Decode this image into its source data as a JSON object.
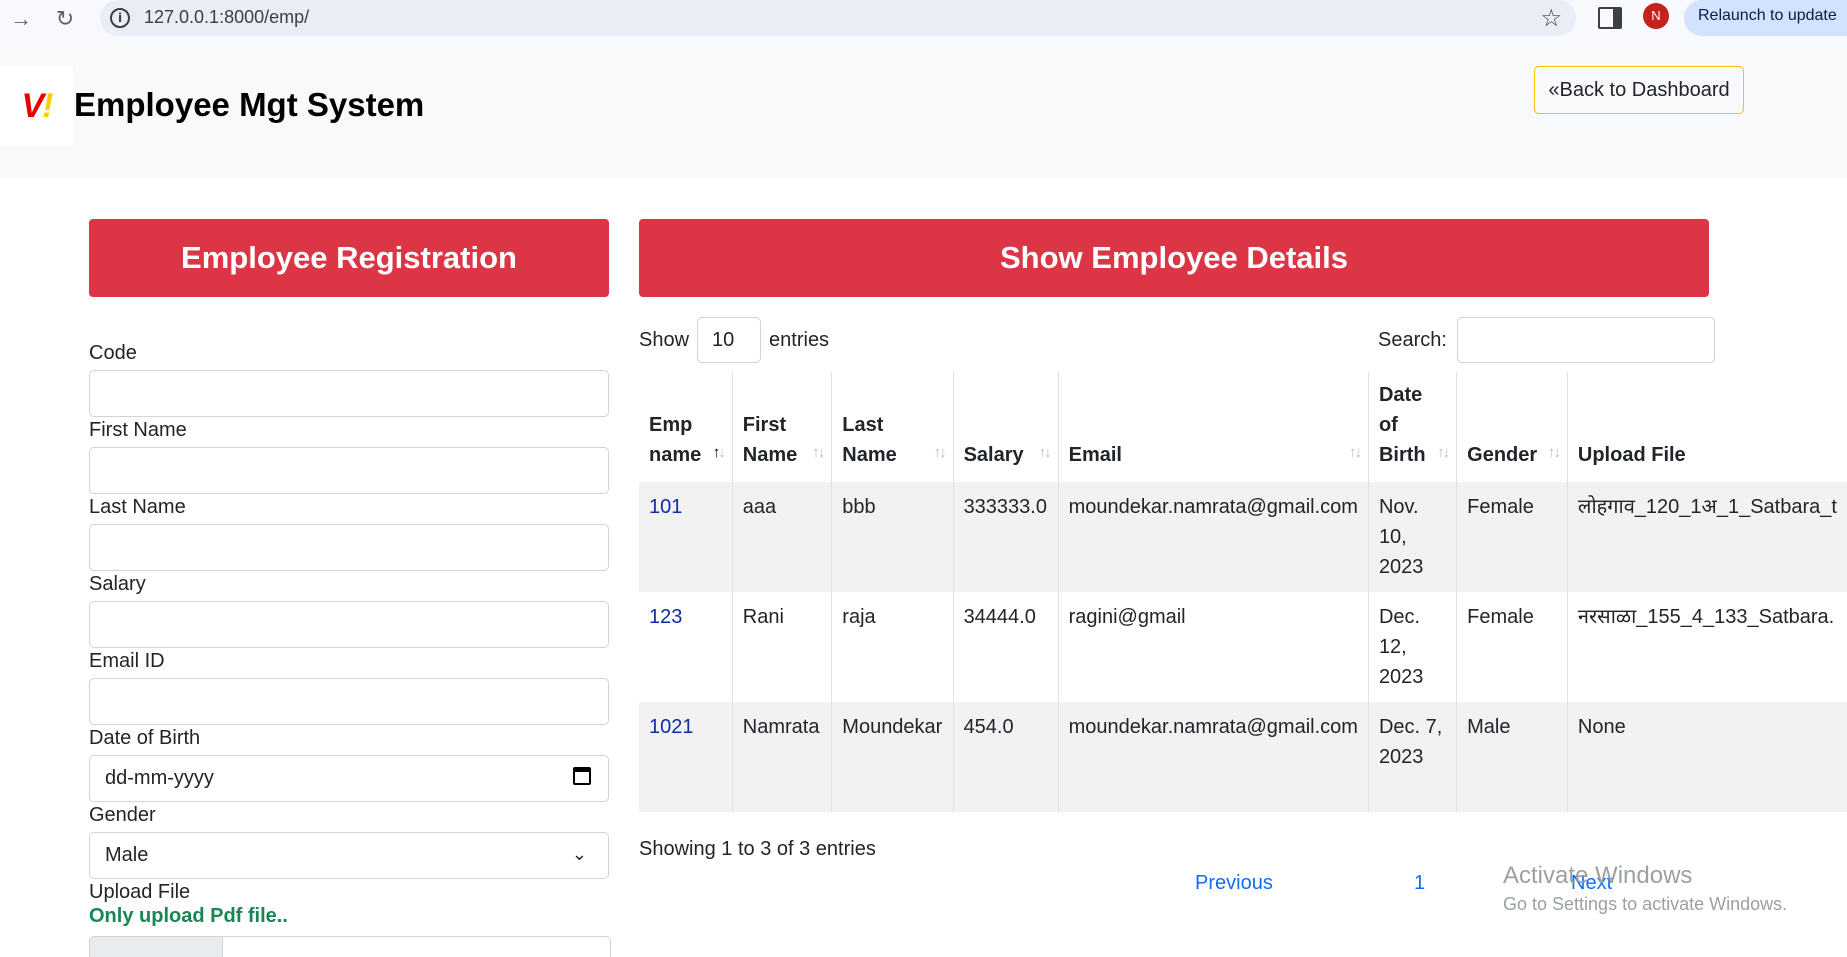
{
  "browser": {
    "url": "127.0.0.1:8000/emp/",
    "avatar_initial": "N",
    "relaunch_label": "Relaunch to update"
  },
  "header": {
    "logo_text": "V",
    "logo_dot": "!",
    "brand": "Employee Mgt System",
    "back_button": "«Back to Dashboard"
  },
  "registration": {
    "title": "Employee Registration",
    "fields": {
      "code": "Code",
      "first_name": "First Name",
      "last_name": "Last Name",
      "salary": "Salary",
      "email": "Email ID",
      "dob": "Date of Birth",
      "dob_placeholder": "dd-mm-yyyy",
      "gender": "Gender",
      "gender_value": "Male",
      "upload": "Upload File",
      "upload_note": "Only upload Pdf file.."
    }
  },
  "details": {
    "title": "Show Employee Details",
    "show_label": "Show",
    "entries_value": "10",
    "entries_label": "entries",
    "search_label": "Search:",
    "columns": [
      "Emp name",
      "First Name",
      "Last Name",
      "Salary",
      "Email",
      "Date of Birth",
      "Gender",
      "Upload File"
    ],
    "rows": [
      {
        "emp": "101",
        "first": "aaa",
        "last": "bbb",
        "salary": "333333.0",
        "email": "moundekar.namrata@gmail.com",
        "dob": "Nov. 10, 2023",
        "gender": "Female",
        "file": "लोहगाव_120_1अ_1_Satbara_t"
      },
      {
        "emp": "123",
        "first": "Rani",
        "last": "raja",
        "salary": "34444.0",
        "email": "ragini@gmail",
        "dob": "Dec. 12, 2023",
        "gender": "Female",
        "file": "नरसाळा_155_4_133_Satbara."
      },
      {
        "emp": "1021",
        "first": "Namrata",
        "last": "Moundekar",
        "salary": "454.0",
        "email": "moundekar.namrata@gmail.com",
        "dob": "Dec. 7, 2023",
        "gender": "Male",
        "file": "None"
      }
    ],
    "info": "Showing 1 to 3 of 3 entries",
    "pagination": {
      "previous": "Previous",
      "page": "1",
      "next": "Next"
    }
  },
  "watermark": {
    "line1": "Activate Windows",
    "line2": "Go to Settings to activate Windows."
  }
}
